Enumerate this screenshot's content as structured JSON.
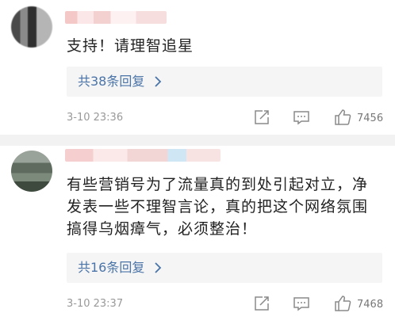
{
  "comments": [
    {
      "text": "支持！请理智追星",
      "reply_label": "共38条回复",
      "time": "3-10 23:36",
      "likes": "7456"
    },
    {
      "text_lines": [
        "有些营销号为了流量真的到处引起对立，净",
        "发表一些不理智言论，真的把这个网络氛围",
        "搞得乌烟瘴气，必须整治！"
      ],
      "reply_label": "共16条回复",
      "time": "3-10 23:37",
      "likes": "7468"
    }
  ],
  "icons": {
    "share": "share-icon",
    "comment": "comment-icon",
    "like": "thumbs-up-icon",
    "chevron": "chevron-right-icon"
  },
  "colors": {
    "link": "#4a74a8",
    "separator": "#f2f2f2",
    "reply_bg": "#f5f5f5",
    "meta_text": "#999999"
  }
}
